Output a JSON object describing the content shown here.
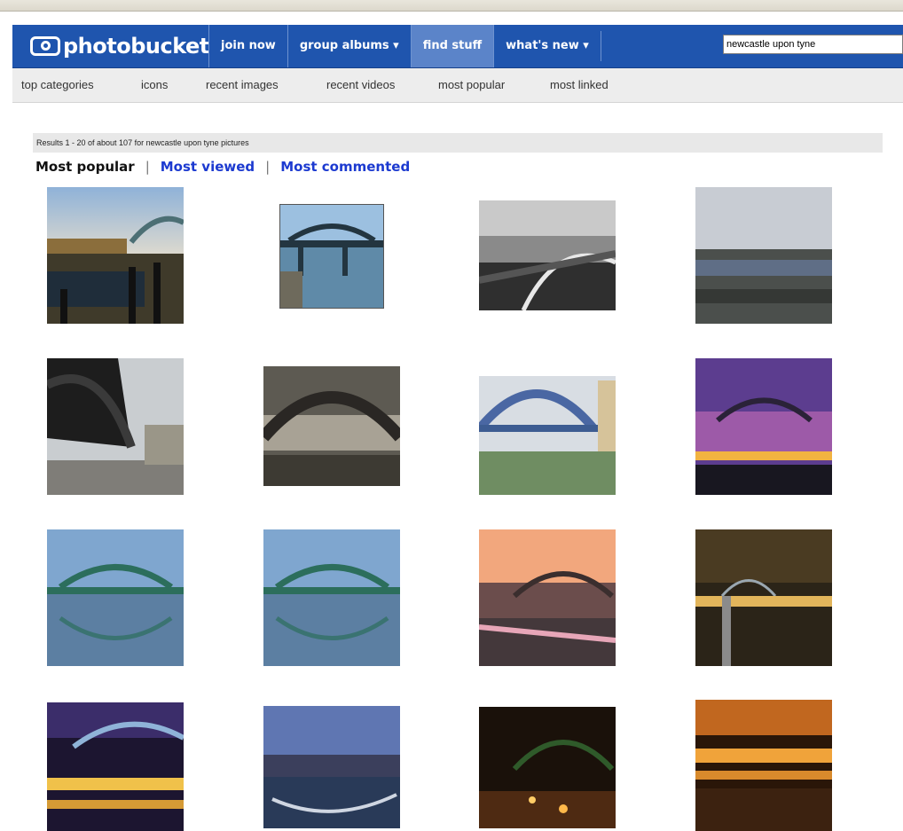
{
  "header": {
    "logo_text": "photobucket",
    "nav": [
      {
        "label": "join now"
      },
      {
        "label": "group albums ▾"
      },
      {
        "label": "find stuff"
      },
      {
        "label": "what's new ▾"
      }
    ],
    "search_value": "newcastle upon tyne"
  },
  "subnav": {
    "items": [
      "top categories",
      "icons",
      "recent images",
      "recent videos",
      "most popular",
      "most linked"
    ]
  },
  "results": {
    "summary": "Results 1 - 20 of about 107 for newcastle upon tyne pictures",
    "sort": {
      "current": "Most popular",
      "options": [
        "Most viewed",
        "Most commented"
      ]
    }
  },
  "colors": {
    "header_blue": "#1f55ae",
    "active_tab": "#5b84c9",
    "link_blue": "#1c3ad0"
  }
}
